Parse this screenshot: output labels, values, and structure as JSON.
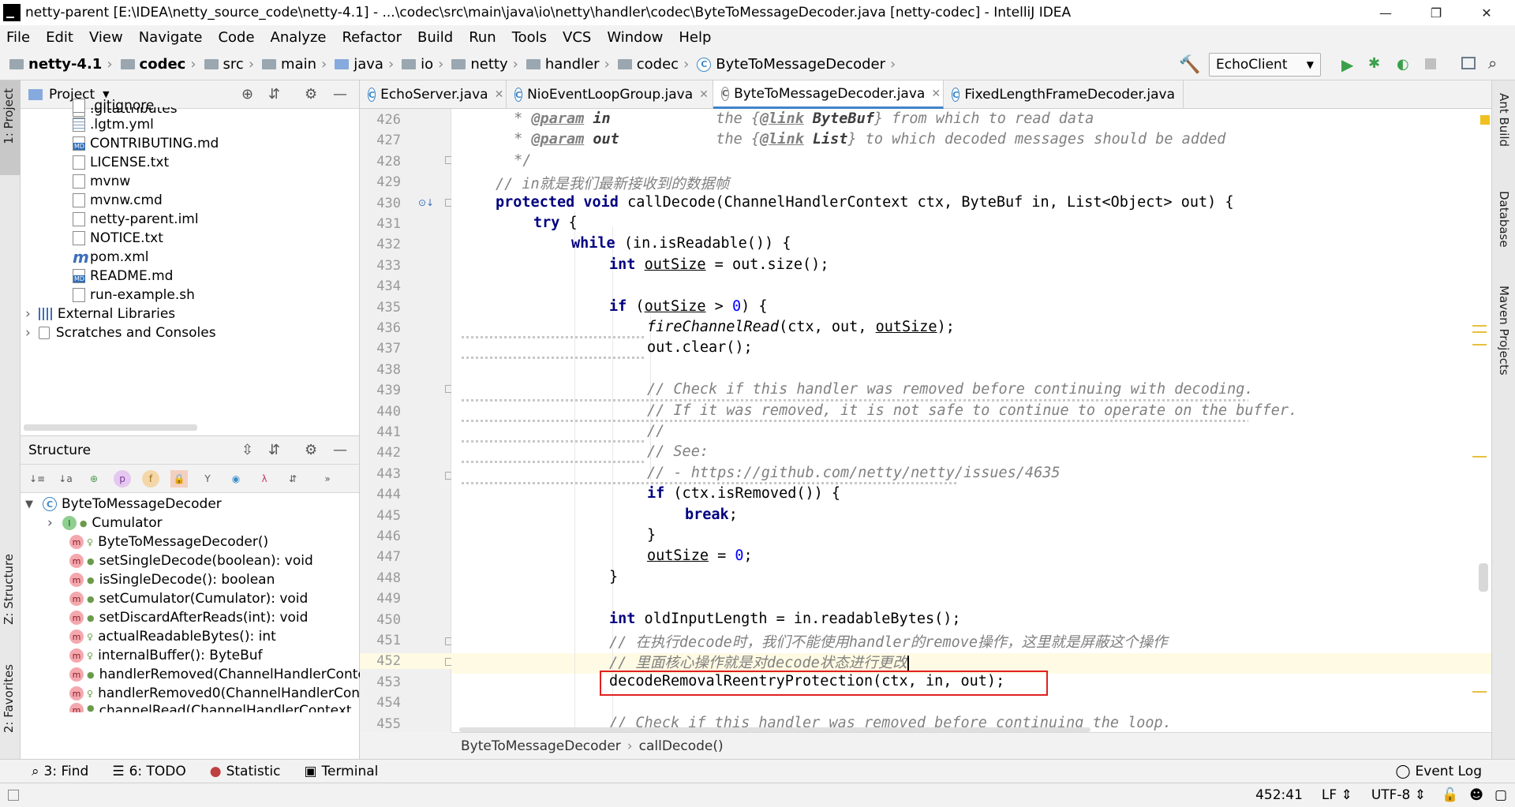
{
  "window": {
    "title": "netty-parent [E:\\IDEA\\netty_source_code\\netty-4.1] - ...\\codec\\src\\main\\java\\io\\netty\\handler\\codec\\ByteToMessageDecoder.java [netty-codec] - IntelliJ IDEA",
    "minimize": "—",
    "maximize": "❐",
    "close": "✕"
  },
  "menu": [
    "File",
    "Edit",
    "View",
    "Navigate",
    "Code",
    "Analyze",
    "Refactor",
    "Build",
    "Run",
    "Tools",
    "VCS",
    "Window",
    "Help"
  ],
  "breadcrumbs": [
    "netty-4.1",
    "codec",
    "src",
    "main",
    "java",
    "io",
    "netty",
    "handler",
    "codec",
    "ByteToMessageDecoder"
  ],
  "toolbar": {
    "run_config": "EchoClient"
  },
  "project_panel": {
    "title": "Project",
    "items": [
      ".gitattributes",
      ".gitignore",
      ".lgtm.yml",
      "CONTRIBUTING.md",
      "LICENSE.txt",
      "mvnw",
      "mvnw.cmd",
      "netty-parent.iml",
      "NOTICE.txt",
      "pom.xml",
      "README.md",
      "run-example.sh",
      "External Libraries",
      "Scratches and Consoles"
    ]
  },
  "structure_panel": {
    "title": "Structure",
    "root": "ByteToMessageDecoder",
    "items": [
      "Cumulator",
      "ByteToMessageDecoder()",
      "setSingleDecode(boolean): void",
      "isSingleDecode(): boolean",
      "setCumulator(Cumulator): void",
      "setDiscardAfterReads(int): void",
      "actualReadableBytes(): int",
      "internalBuffer(): ByteBuf",
      "handlerRemoved(ChannelHandlerConte",
      "handlerRemoved0(ChannelHandlerCont",
      "channelRead(ChannelHandlerContext, C"
    ]
  },
  "tabs": [
    "EchoServer.java",
    "NioEventLoopGroup.java",
    "ByteToMessageDecoder.java",
    "FixedLengthFrameDecoder.java"
  ],
  "active_tab": "ByteToMessageDecoder.java",
  "line_numbers": [
    "426",
    "427",
    "428",
    "429",
    "430",
    "431",
    "432",
    "433",
    "434",
    "435",
    "436",
    "437",
    "438",
    "439",
    "440",
    "441",
    "442",
    "443",
    "444",
    "445",
    "446",
    "447",
    "448",
    "449",
    "450",
    "451",
    "452",
    "453",
    "454",
    "455"
  ],
  "editor_crumb": {
    "class": "ByteToMessageDecoder",
    "method": "callDecode()"
  },
  "left_stripe": {
    "project": "1: Project",
    "structure": "Z: Structure",
    "favorites": "2: Favorites"
  },
  "right_stripe": {
    "ant": "Ant Build",
    "database": "Database",
    "maven": "Maven Projects"
  },
  "bottom_tools": {
    "find": "3: Find",
    "todo": "6: TODO",
    "statistic": "Statistic",
    "terminal": "Terminal",
    "event_log": "Event Log"
  },
  "status": {
    "position": "452:41",
    "line_sep": "LF",
    "encoding": "UTF-8"
  }
}
